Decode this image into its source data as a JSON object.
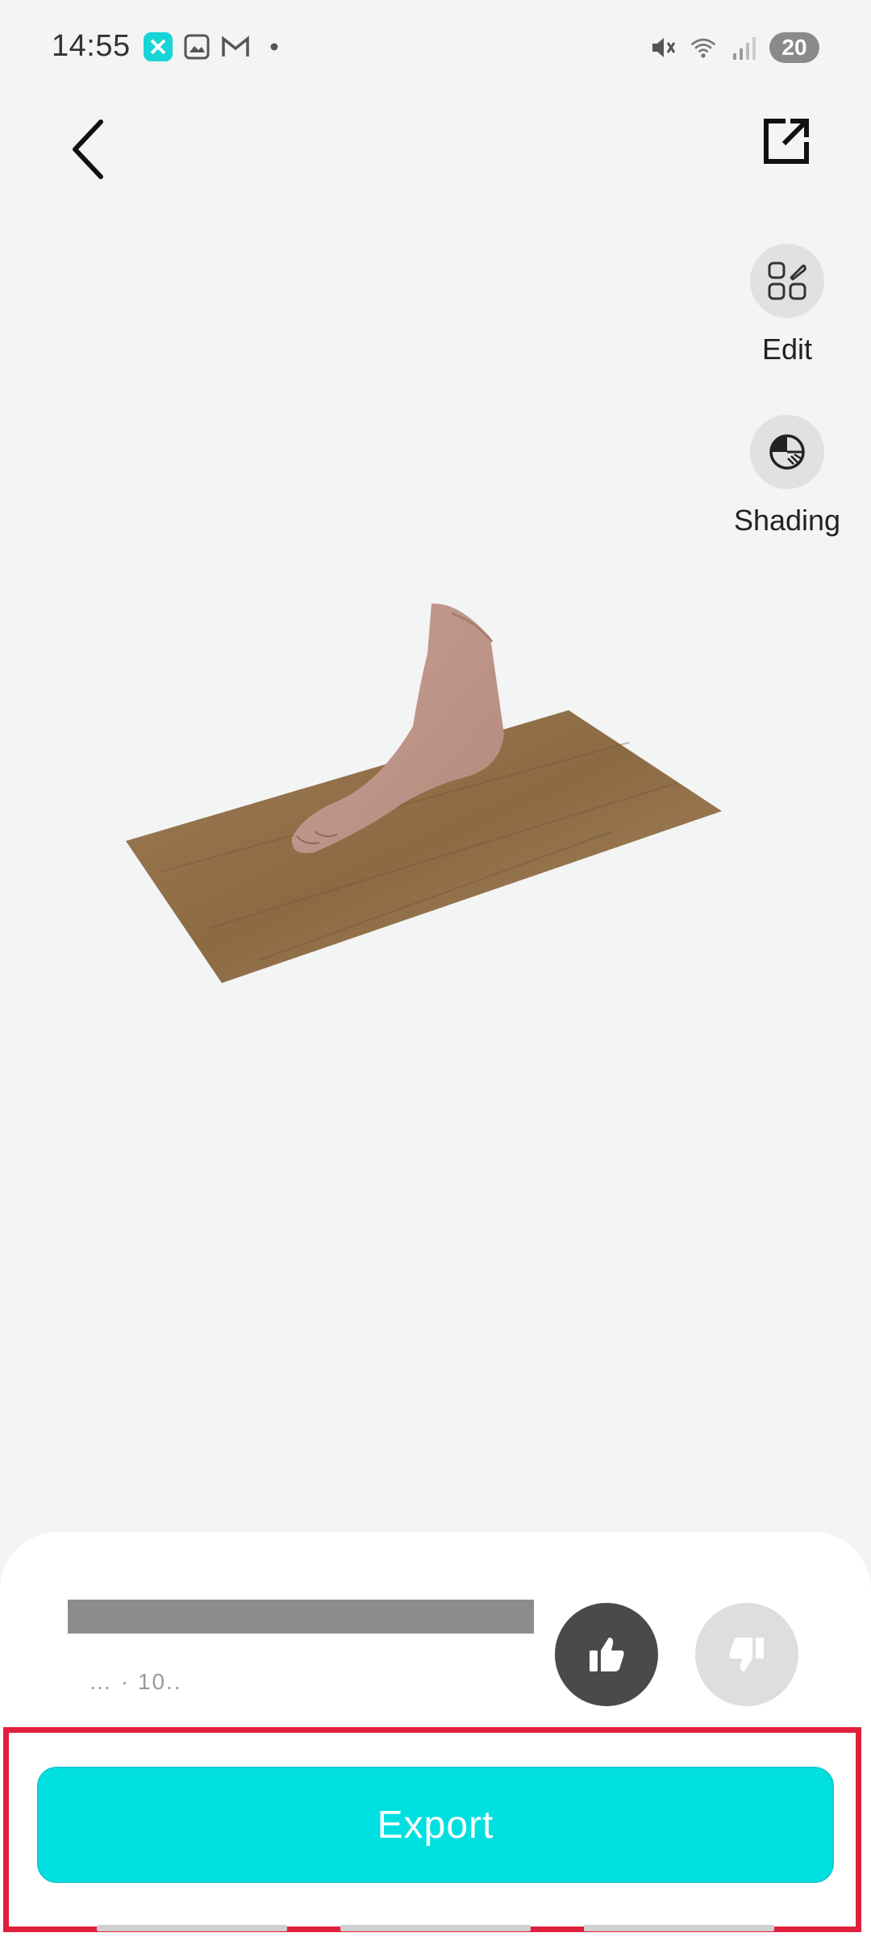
{
  "status_bar": {
    "time": "14:55",
    "battery": "20",
    "left_icons": [
      "app-icon",
      "photo-icon",
      "gmail-icon",
      "dot-icon"
    ],
    "right_icons": [
      "mute-icon",
      "wifi-icon",
      "signal-icon",
      "battery-icon"
    ]
  },
  "toolbar": {
    "back_icon": "chevron-left-icon",
    "share_icon": "share-external-icon"
  },
  "side_tools": [
    {
      "label": "Edit",
      "icon": "grid-edit-icon"
    },
    {
      "label": "Shading",
      "icon": "shading-icon"
    }
  ],
  "model": {
    "subject": "3D scan of foot on wooden board"
  },
  "feedback": {
    "thumbs_up_icon": "thumbs-up-icon",
    "thumbs_down_icon": "thumbs-down-icon",
    "sub_text": "…  ·  10.."
  },
  "export": {
    "label": "Export"
  },
  "colors": {
    "accent": "#00e0e0",
    "highlight": "#e01f3d"
  }
}
